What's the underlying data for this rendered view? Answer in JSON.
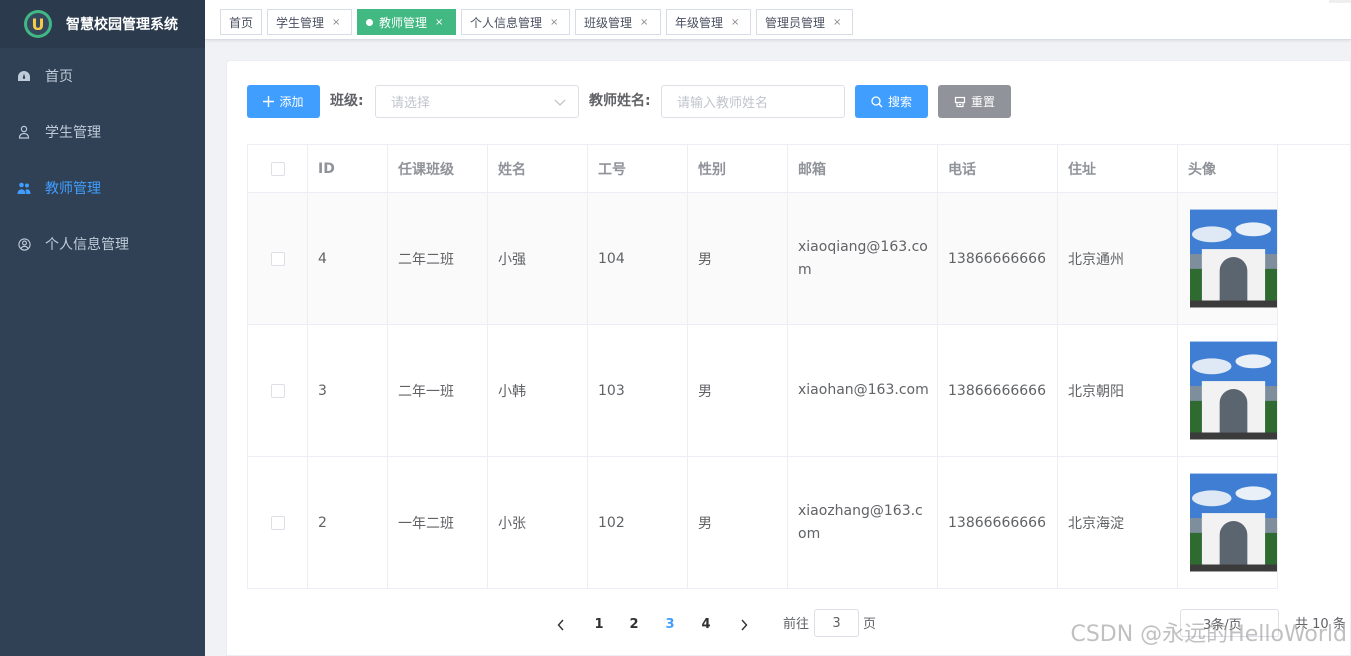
{
  "app": {
    "title": "智慧校园管理系统",
    "logo_letter": "U"
  },
  "sidebar": {
    "items": [
      {
        "label": "首页",
        "icon": "dashboard-icon",
        "active": false
      },
      {
        "label": "学生管理",
        "icon": "user-icon",
        "active": false
      },
      {
        "label": "教师管理",
        "icon": "users-icon",
        "active": true
      },
      {
        "label": "个人信息管理",
        "icon": "account-icon",
        "active": false
      }
    ]
  },
  "tags": [
    {
      "label": "首页",
      "closable": false,
      "active": false
    },
    {
      "label": "学生管理",
      "closable": true,
      "active": false
    },
    {
      "label": "教师管理",
      "closable": true,
      "active": true
    },
    {
      "label": "个人信息管理",
      "closable": true,
      "active": false
    },
    {
      "label": "班级管理",
      "closable": true,
      "active": false
    },
    {
      "label": "年级管理",
      "closable": true,
      "active": false
    },
    {
      "label": "管理员管理",
      "closable": true,
      "active": false
    }
  ],
  "toolbar": {
    "add_label": "添加",
    "class_label": "班级:",
    "class_placeholder": "请选择",
    "name_label": "教师姓名:",
    "name_placeholder": "请输入教师姓名",
    "search_label": "搜索",
    "reset_label": "重置"
  },
  "table": {
    "columns": [
      "ID",
      "任课班级",
      "姓名",
      "工号",
      "性别",
      "邮箱",
      "电话",
      "住址",
      "头像"
    ],
    "rows": [
      {
        "id": "4",
        "class": "二年二班",
        "name": "小强",
        "job_no": "104",
        "gender": "男",
        "email": "xiaoqiang@163.com",
        "phone": "13866666666",
        "address": "北京通州"
      },
      {
        "id": "3",
        "class": "二年一班",
        "name": "小韩",
        "job_no": "103",
        "gender": "男",
        "email": "xiaohan@163.com",
        "phone": "13866666666",
        "address": "北京朝阳"
      },
      {
        "id": "2",
        "class": "一年二班",
        "name": "小张",
        "job_no": "102",
        "gender": "男",
        "email": "xiaozhang@163.com",
        "phone": "13866666666",
        "address": "北京海淀"
      }
    ]
  },
  "pagination": {
    "pages": [
      "1",
      "2",
      "3",
      "4"
    ],
    "current": "3",
    "goto_prefix": "前往",
    "goto_value": "3",
    "goto_suffix": "页",
    "page_size": "3条/页",
    "total": "共 10 条"
  },
  "watermark": "CSDN @永远的HelloWorld",
  "colors": {
    "primary": "#409eff",
    "sidebar": "#304156",
    "tag_active": "#42b983",
    "reset": "#909399"
  }
}
